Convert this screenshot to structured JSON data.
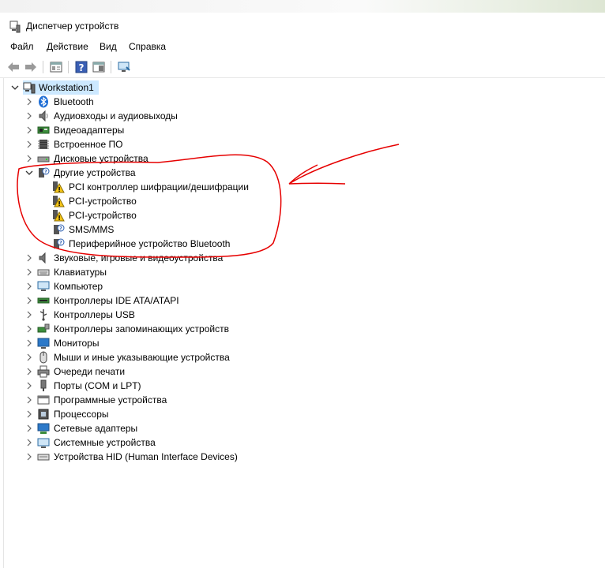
{
  "window": {
    "title": "Диспетчер устройств"
  },
  "menu": [
    "Файл",
    "Действие",
    "Вид",
    "Справка"
  ],
  "toolbar": {
    "buttons": [
      "back-icon",
      "forward-icon",
      "properties-icon",
      "help-icon",
      "action-pane-icon",
      "monitor-scan-icon"
    ]
  },
  "tree": {
    "root": "Workstation1",
    "categories": [
      "Bluetooth",
      "Аудиовходы и аудиовыходы",
      "Видеоадаптеры",
      "Встроенное ПО",
      "Дисковые устройства",
      "Другие устройства"
    ],
    "other_devices": [
      "PCI контроллер шифрации/дешифрации",
      "PCI-устройство",
      "PCI-устройство",
      "SMS/MMS",
      "Периферийное устройство Bluetooth"
    ],
    "categories_after": [
      "Звуковые, игровые и видеоустройства",
      "Клавиатуры",
      "Компьютер",
      "Контроллеры IDE ATA/ATAPI",
      "Контроллеры USB",
      "Контроллеры запоминающих устройств",
      "Мониторы",
      "Мыши и иные указывающие устройства",
      "Очереди печати",
      "Порты (COM и LPT)",
      "Программные устройства",
      "Процессоры",
      "Сетевые адаптеры",
      "Системные устройства",
      "Устройства HID (Human Interface Devices)"
    ]
  },
  "colors": {
    "selection": "#cce8ff",
    "annotation": "#e60000",
    "warning": "#f5c518"
  }
}
